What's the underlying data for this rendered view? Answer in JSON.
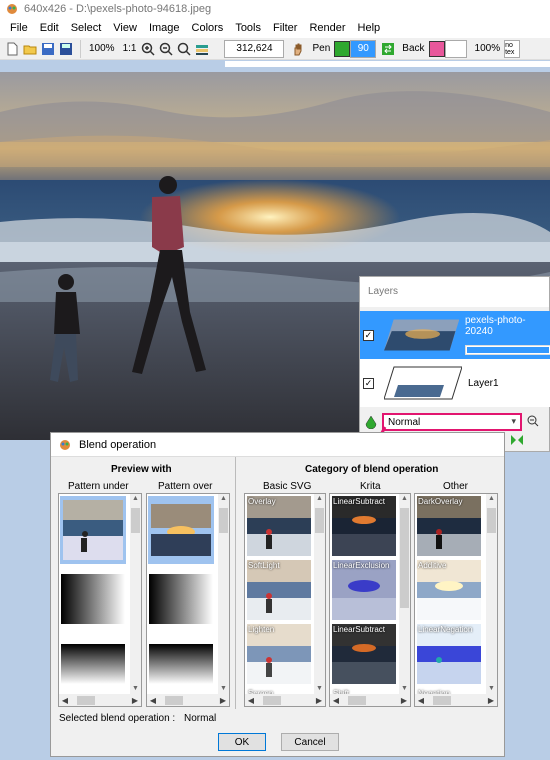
{
  "window": {
    "title": "640x426 - D:\\pexels-photo-94618.jpeg"
  },
  "menu": [
    "File",
    "Edit",
    "Select",
    "View",
    "Image",
    "Colors",
    "Tools",
    "Filter",
    "Render",
    "Help"
  ],
  "toolbar": {
    "zoom_100": "100%",
    "ratio": "1:1",
    "coords": "312,624",
    "pen_label": "Pen",
    "pen_value": "90",
    "back_label": "Back",
    "opacity": "100%",
    "no_text": "no tex"
  },
  "layers": {
    "title": "Layers",
    "items": [
      {
        "name": "pexels-photo-20240",
        "selected": true
      },
      {
        "name": "Layer1",
        "selected": false
      }
    ],
    "blend_mode": "Normal"
  },
  "dialog": {
    "title": "Blend operation",
    "preview_title": "Preview with",
    "pattern_under": "Pattern under",
    "pattern_over": "Pattern over",
    "category_title": "Category of blend operation",
    "categories": [
      "Basic SVG",
      "Krita",
      "Other"
    ],
    "basic_svg": [
      "Overlay",
      "SoftLight",
      "Lighten",
      "Screen"
    ],
    "krita": [
      "LinearSubtract",
      "LinearExclusion",
      "LinearSubtract",
      "Shift"
    ],
    "other": [
      "DarkOverlay",
      "Additive",
      "LinearNegation",
      "Negation"
    ],
    "selected_label": "Selected blend operation :",
    "selected_value": "Normal",
    "ok": "OK",
    "cancel": "Cancel"
  },
  "colors": {
    "accent": "#e2156f",
    "pen_color": "#2fa82f",
    "back_color": "#e8579b",
    "selection": "#3399ff"
  }
}
